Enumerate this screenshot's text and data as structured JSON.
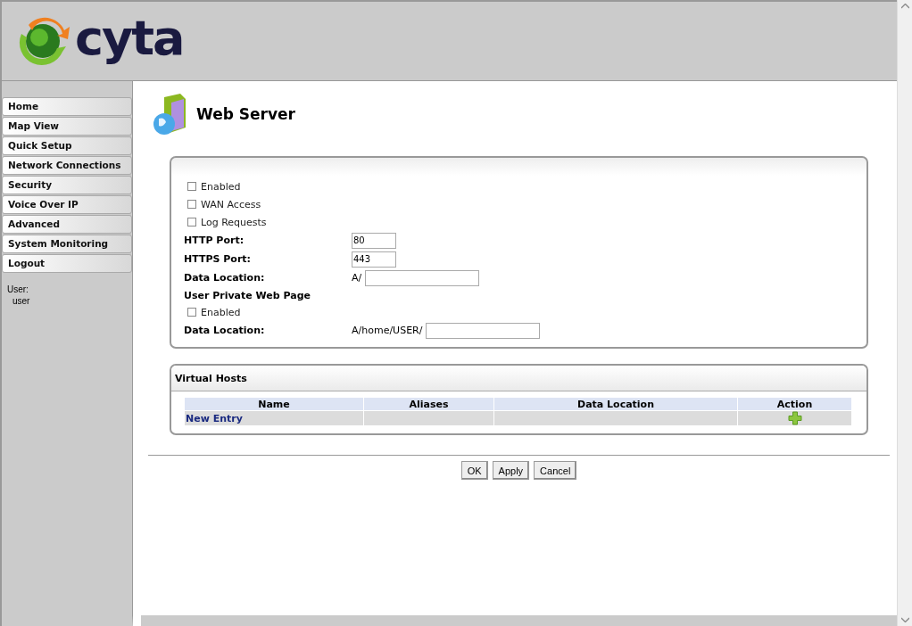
{
  "logo": {
    "text": "cyta"
  },
  "nav": [
    {
      "label": "Home"
    },
    {
      "label": "Map View"
    },
    {
      "label": "Quick Setup"
    },
    {
      "label": "Network Connections"
    },
    {
      "label": "Security"
    },
    {
      "label": "Voice Over IP"
    },
    {
      "label": "Advanced"
    },
    {
      "label": "System Monitoring"
    },
    {
      "label": "Logout"
    }
  ],
  "user": {
    "label": "User:",
    "name": "user"
  },
  "page": {
    "title": "Web Server"
  },
  "settings": [
    {
      "kind": "checkbox",
      "label": "Enabled",
      "checked": false
    },
    {
      "kind": "checkbox",
      "label": "WAN Access",
      "checked": false
    },
    {
      "kind": "checkbox",
      "label": "Log Requests",
      "checked": false
    },
    {
      "kind": "port",
      "label": "HTTP Port:",
      "value": "80"
    },
    {
      "kind": "port",
      "label": "HTTPS Port:",
      "value": "443"
    },
    {
      "kind": "location",
      "label": "Data Location:",
      "prefix": "A/"
    },
    {
      "kind": "heading",
      "label": "User Private Web Page"
    },
    {
      "kind": "checkbox",
      "label": "Enabled",
      "checked": false
    },
    {
      "kind": "location",
      "label": "Data Location:",
      "prefix": "A/home/USER/"
    }
  ],
  "virtual_hosts": {
    "title": "Virtual Hosts",
    "columns": [
      "Name",
      "Aliases",
      "Data Location",
      "Action"
    ],
    "rows": [
      {
        "name": "New Entry"
      }
    ]
  },
  "buttons": [
    "OK",
    "Apply",
    "Cancel"
  ]
}
